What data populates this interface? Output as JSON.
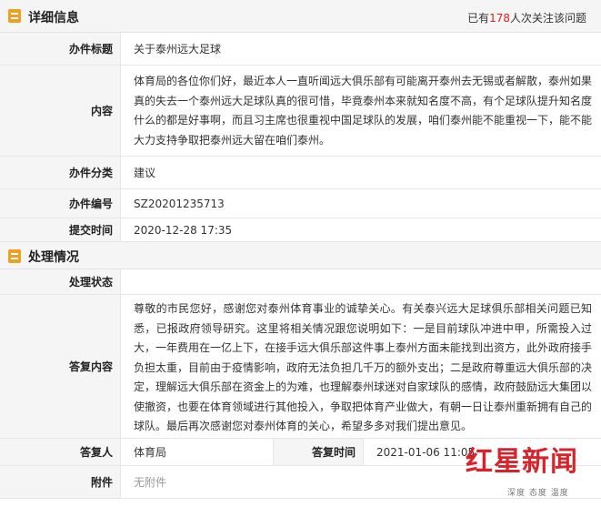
{
  "detail": {
    "title": "详细信息",
    "follow_prefix": "已有",
    "follow_count": "178",
    "follow_suffix": "人次关注该问题",
    "subject_label": "办件标题",
    "subject": "关于泰州远大足球",
    "content_label": "内容",
    "content": "体育局的各位你们好，最近本人一直听闻远大俱乐部有可能离开泰州去无锡或者解散，泰州如果真的失去一个泰州远大足球队真的很可惜，毕竟泰州本来就知名度不高，有个足球队提升知名度什么的都是好事啊，而且习主席也很重视中国足球队的发展，咱们泰州能不能重视一下，能不能大力支持争取把泰州远大留在咱们泰州。",
    "category_label": "办件分类",
    "category": "建议",
    "number_label": "办件编号",
    "number": "SZ20201235713",
    "submit_time_label": "提交时间",
    "submit_time": "2020-12-28 17:35"
  },
  "handling": {
    "title": "处理情况",
    "status_label": "处理状态",
    "status": "",
    "reply_label": "答复内容",
    "reply": "尊敬的市民您好，感谢您对泰州体育事业的诚挚关心。有关泰兴远大足球俱乐部相关问题已知悉，已报政府领导研究。这里将相关情况跟您说明如下：一是目前球队冲进中甲，所需投入过大，一年费用在一亿上下，在接手远大俱乐部这件事上泰州方面未能找到出资方，此外政府接手负担太重，目前由于疫情影响，政府无法负担几千万的额外支出；二是政府尊重远大俱乐部的决定，理解远大俱乐部在资金上的为难，也理解泰州球迷对自家球队的感情，政府鼓励远大集团以使撤资，也要在体育领域进行其他投入，争取把体育产业做大，有朝一日让泰州重新拥有自己的球队。最后再次感谢您对泰州体育的关心，希望多多对我们提出意见。",
    "responder_label": "答复人",
    "responder": "体育局",
    "reply_time_label": "答复时间",
    "reply_time": "2021-01-06 11:05",
    "attachment_label": "附件",
    "attachment": "无附件"
  },
  "watermark": {
    "brand": "红星新闻",
    "tagline": "深度 态度 温度"
  },
  "colors": {
    "accent": "#f0a020",
    "count": "#e02020",
    "brand": "#d8232a"
  }
}
